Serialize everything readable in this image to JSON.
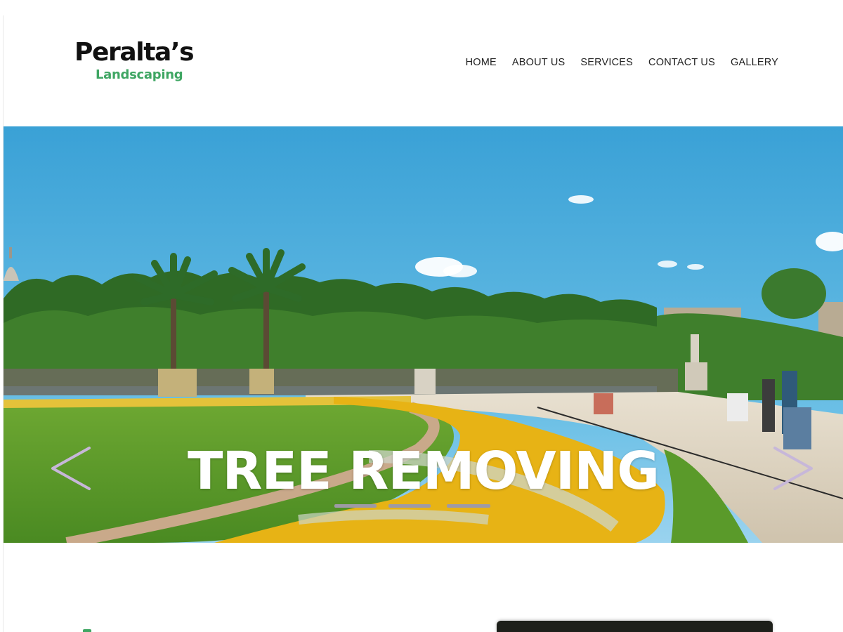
{
  "brand": {
    "name": "Peralta’s",
    "tagline": "Landscaping",
    "accent_color": "#3fa663"
  },
  "nav": {
    "items": [
      "HOME",
      "ABOUT US",
      "SERVICES",
      "CONTACT US",
      "GALLERY"
    ]
  },
  "hero": {
    "title": "TREE REMOVING",
    "prev_icon": "chevron-left-icon",
    "next_icon": "chevron-right-icon",
    "slide_count": 3,
    "indicator_color": "#9e9aa6"
  }
}
